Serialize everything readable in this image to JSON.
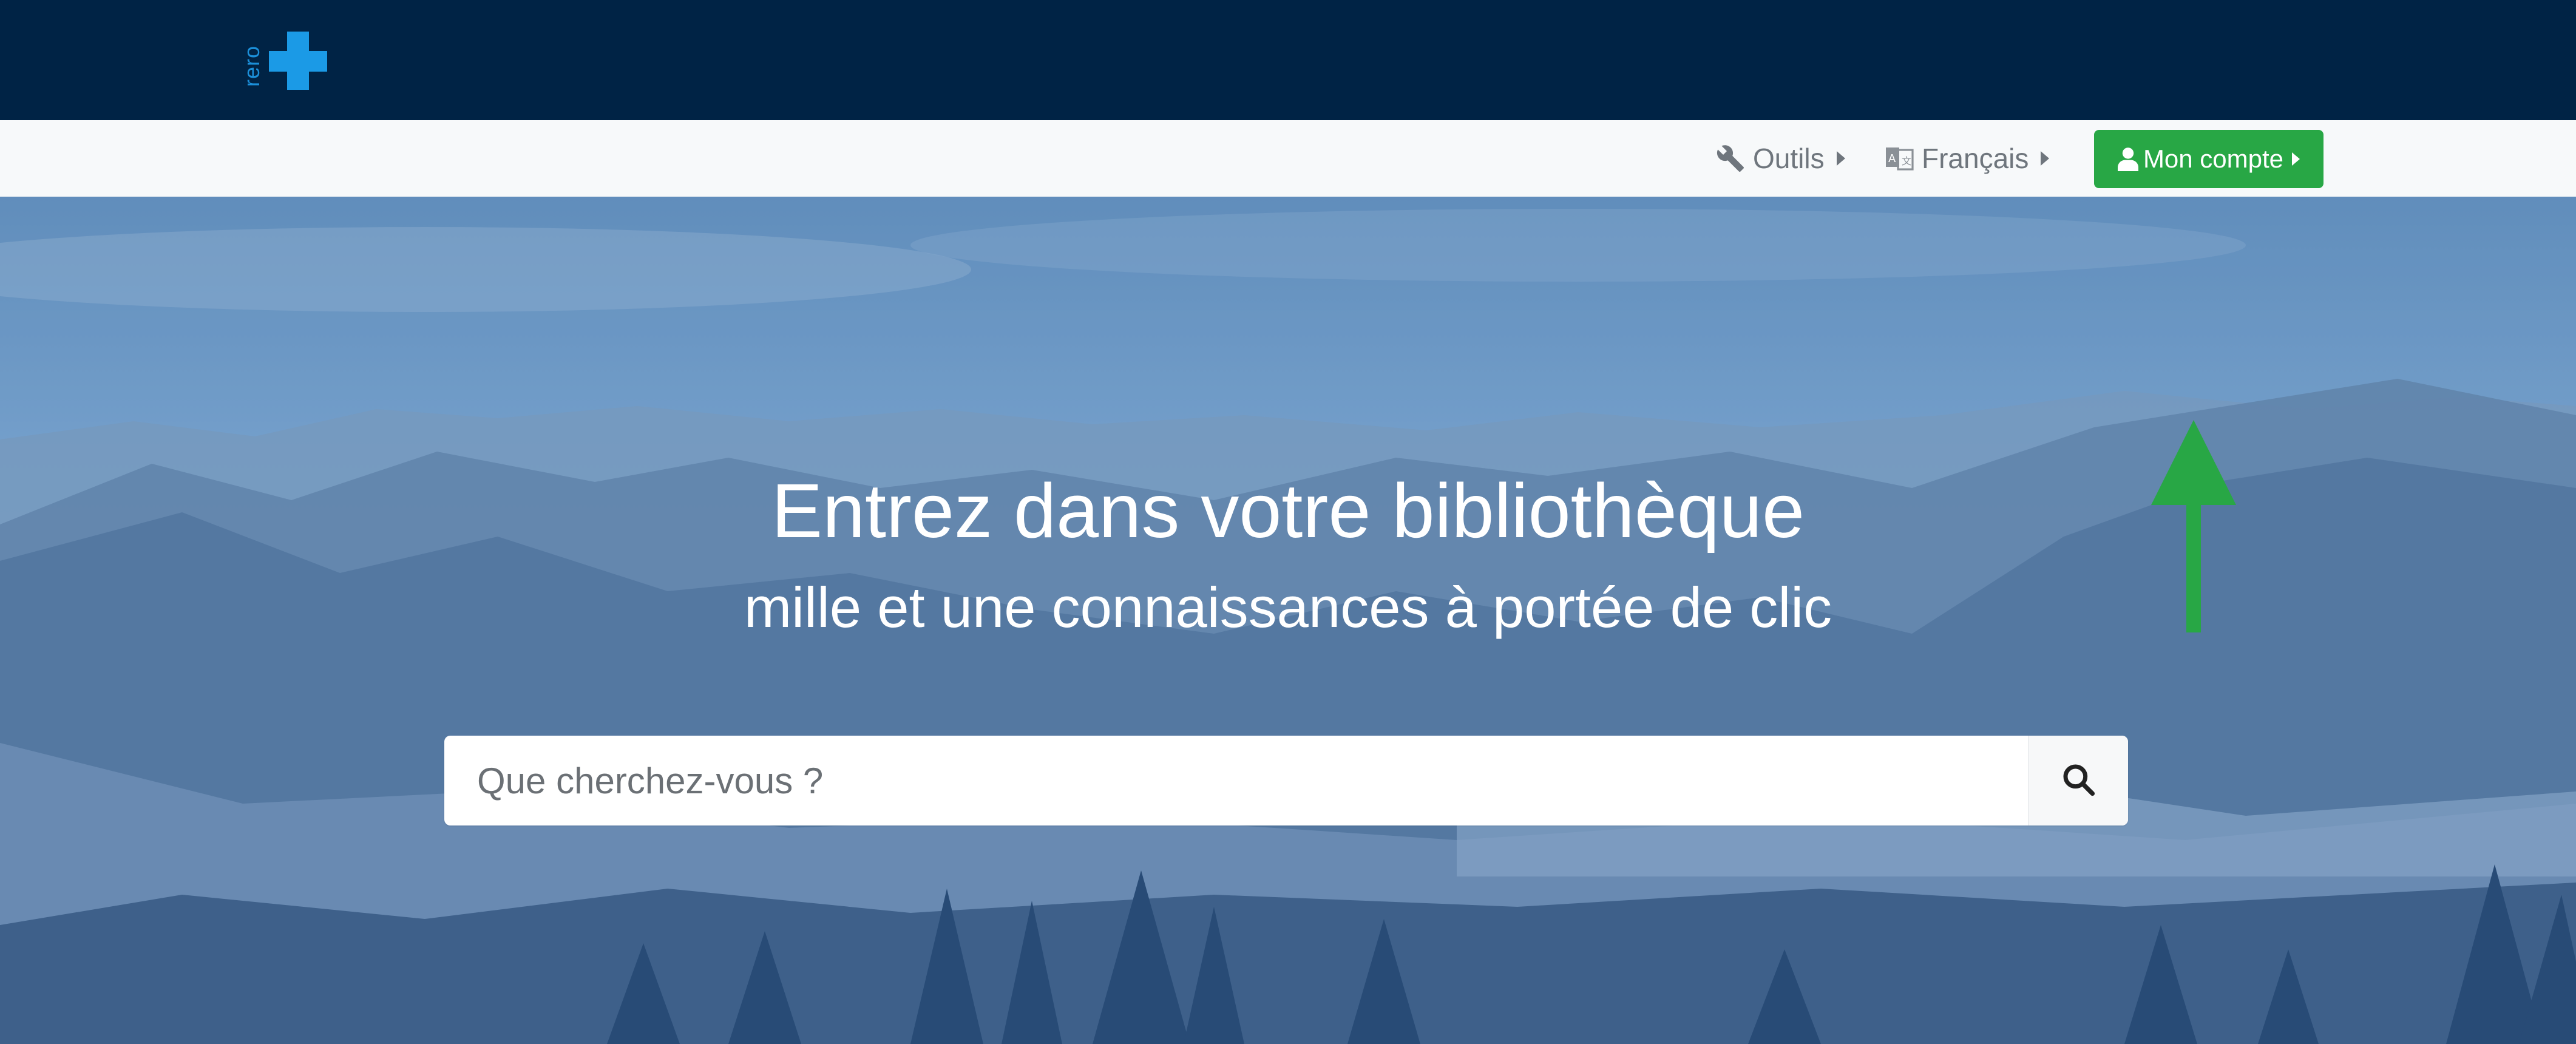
{
  "header": {
    "logo_text": "rero",
    "brand_color": "#002345"
  },
  "nav": {
    "tools_label": "Outils",
    "language_label": "Français",
    "account_label": "Mon compte",
    "account_color": "#28a745"
  },
  "hero": {
    "title": "Entrez dans votre bibliothèque",
    "subtitle": "mille et une connaissances à portée de clic"
  },
  "search": {
    "placeholder": "Que cherchez-vous ?",
    "value": ""
  },
  "icons": {
    "tools": "wrench-icon",
    "language": "language-icon",
    "account": "user-icon",
    "search": "search-icon",
    "annotation": "arrow-up-icon"
  },
  "annotation": {
    "arrow_color": "#28a745"
  }
}
